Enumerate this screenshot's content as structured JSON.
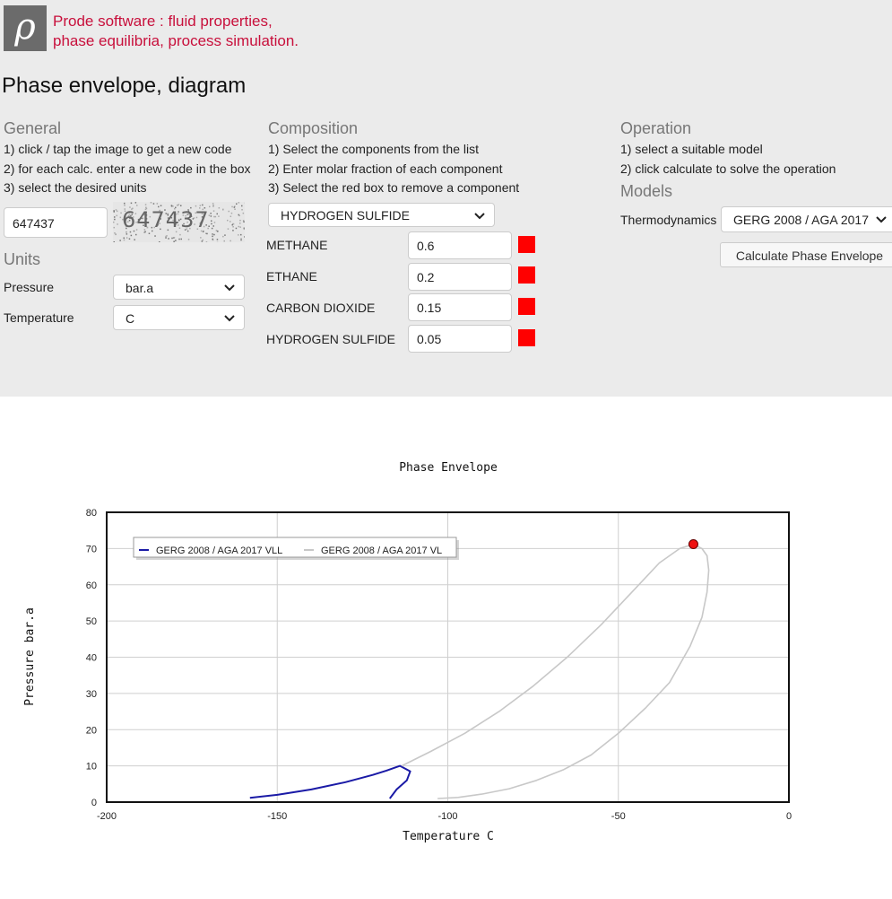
{
  "header": {
    "logo_letter": "ρ",
    "brand_line1": "Prode software : fluid properties,",
    "brand_line2": "phase equilibria, process simulation.",
    "page_title": "Phase envelope, diagram"
  },
  "general": {
    "heading": "General",
    "steps": [
      "1) click / tap the image to get a new code",
      "2) for each calc. enter a new code in the box",
      "3) select the desired units"
    ],
    "code_value": "647437",
    "captcha_text": "647437"
  },
  "units": {
    "heading": "Units",
    "pressure_label": "Pressure",
    "pressure_value": "bar.a",
    "temperature_label": "Temperature",
    "temperature_value": "C"
  },
  "composition": {
    "heading": "Composition",
    "steps": [
      "1) Select the components from the list",
      "2) Enter molar fraction of each component",
      "3) Select the red box to remove a component"
    ],
    "selected_component": "HYDROGEN SULFIDE",
    "components": [
      {
        "name": "METHANE",
        "fraction": "0.6"
      },
      {
        "name": "ETHANE",
        "fraction": "0.2"
      },
      {
        "name": "CARBON DIOXIDE",
        "fraction": "0.15"
      },
      {
        "name": "HYDROGEN SULFIDE",
        "fraction": "0.05"
      }
    ],
    "remove_color": "#ff0000"
  },
  "operation": {
    "heading": "Operation",
    "steps": [
      "1) select a suitable model",
      "2) click calculate to solve the operation"
    ],
    "models_heading": "Models",
    "thermo_label": "Thermodynamics",
    "thermo_value": "GERG 2008 / AGA 2017",
    "calc_button": "Calculate Phase Envelope"
  },
  "chart_data": {
    "type": "line",
    "title": "Phase Envelope",
    "xlabel": "Temperature C",
    "ylabel": "Pressure bar.a",
    "xlim": [
      -200,
      0
    ],
    "ylim": [
      0,
      80
    ],
    "xticks": [
      -200,
      -150,
      -100,
      -50,
      0
    ],
    "yticks": [
      0,
      10,
      20,
      30,
      40,
      50,
      60,
      70,
      80
    ],
    "grid": true,
    "legend_position": "top-left",
    "series": [
      {
        "name": "GERG 2008 / AGA 2017 VLL",
        "color": "#1a1aa6",
        "x": [
          -158,
          -150,
          -140,
          -130,
          -122,
          -118,
          -114,
          -111,
          -112,
          -115,
          -117
        ],
        "y": [
          1.2,
          2,
          3.5,
          5.5,
          7.5,
          8.7,
          10,
          8.5,
          6,
          3.5,
          1
        ]
      },
      {
        "name": "GERG 2008 / AGA 2017 VL",
        "color": "#c8c8c8",
        "x": [
          -113.5,
          -105,
          -95,
          -85,
          -75,
          -65,
          -55,
          -45,
          -38,
          -32,
          -28,
          -25.5,
          -24,
          -23.5,
          -24,
          -25.5,
          -29,
          -35,
          -42,
          -50,
          -58,
          -66,
          -74,
          -82,
          -90,
          -97,
          -103
        ],
        "y": [
          10,
          14,
          19,
          25,
          32,
          40,
          49,
          59,
          66,
          70,
          71.2,
          70,
          68,
          64,
          58,
          51,
          43,
          33,
          26,
          19,
          13,
          9,
          6,
          3.7,
          2.2,
          1.3,
          1
        ]
      }
    ],
    "critical_point": {
      "x": -28,
      "y": 71.2,
      "color": "#ee1111"
    }
  }
}
